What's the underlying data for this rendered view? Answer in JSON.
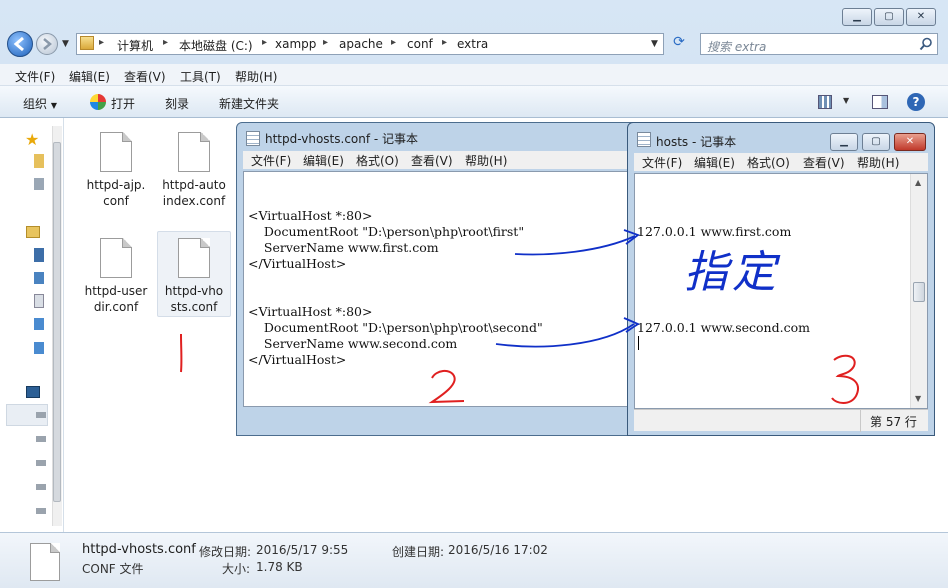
{
  "explorer": {
    "breadcrumb": [
      "计算机",
      "本地磁盘 (C:)",
      "xampp",
      "apache",
      "conf",
      "extra"
    ],
    "search_placeholder": "搜索 extra",
    "menu": [
      "文件(F)",
      "编辑(E)",
      "查看(V)",
      "工具(T)",
      "帮助(H)"
    ],
    "toolbar": {
      "organize": "组织",
      "open": "打开",
      "burn": "刻录",
      "new_folder": "新建文件夹"
    },
    "files": [
      {
        "name_line1": "httpd-ajp.",
        "name_line2": "conf"
      },
      {
        "name_line1": "httpd-auto",
        "name_line2": "index.conf"
      },
      {
        "name_line1": "httpd-user",
        "name_line2": "dir.conf"
      },
      {
        "name_line1": "httpd-vho",
        "name_line2": "sts.conf"
      }
    ],
    "details": {
      "filename": "httpd-vhosts.conf",
      "modified_label": "修改日期:",
      "modified_value": "2016/5/17 9:55",
      "created_label": "创建日期:",
      "created_value": "2016/5/16 17:02",
      "type": "CONF 文件",
      "size_label": "大小:",
      "size_value": "1.78 KB"
    }
  },
  "vhosts_notepad": {
    "title": "httpd-vhosts.conf - 记事本",
    "menu": [
      "文件(F)",
      "编辑(E)",
      "格式(O)",
      "查看(V)",
      "帮助(H)"
    ],
    "lines": [
      "<VirtualHost *:80>",
      "    DocumentRoot \"D:\\person\\php\\root\\first\"",
      "    ServerName www.first.com",
      "</VirtualHost>",
      "<VirtualHost *:80>",
      "    DocumentRoot \"D:\\person\\php\\root\\second\"",
      "    ServerName www.second.com",
      "</VirtualHost>"
    ]
  },
  "hosts_notepad": {
    "title": "hosts - 记事本",
    "menu": [
      "文件(F)",
      "编辑(E)",
      "格式(O)",
      "查看(V)",
      "帮助(H)"
    ],
    "lines": [
      "127.0.0.1 www.first.com",
      "127.0.0.1 www.second.com"
    ],
    "status": "第 57 行"
  },
  "annotations": {
    "one": "1",
    "two": "2",
    "three": "3",
    "zhiding": "指定"
  },
  "colors": {
    "red": "#e02020",
    "blue": "#1030c8",
    "selection": "#eef2f7"
  }
}
